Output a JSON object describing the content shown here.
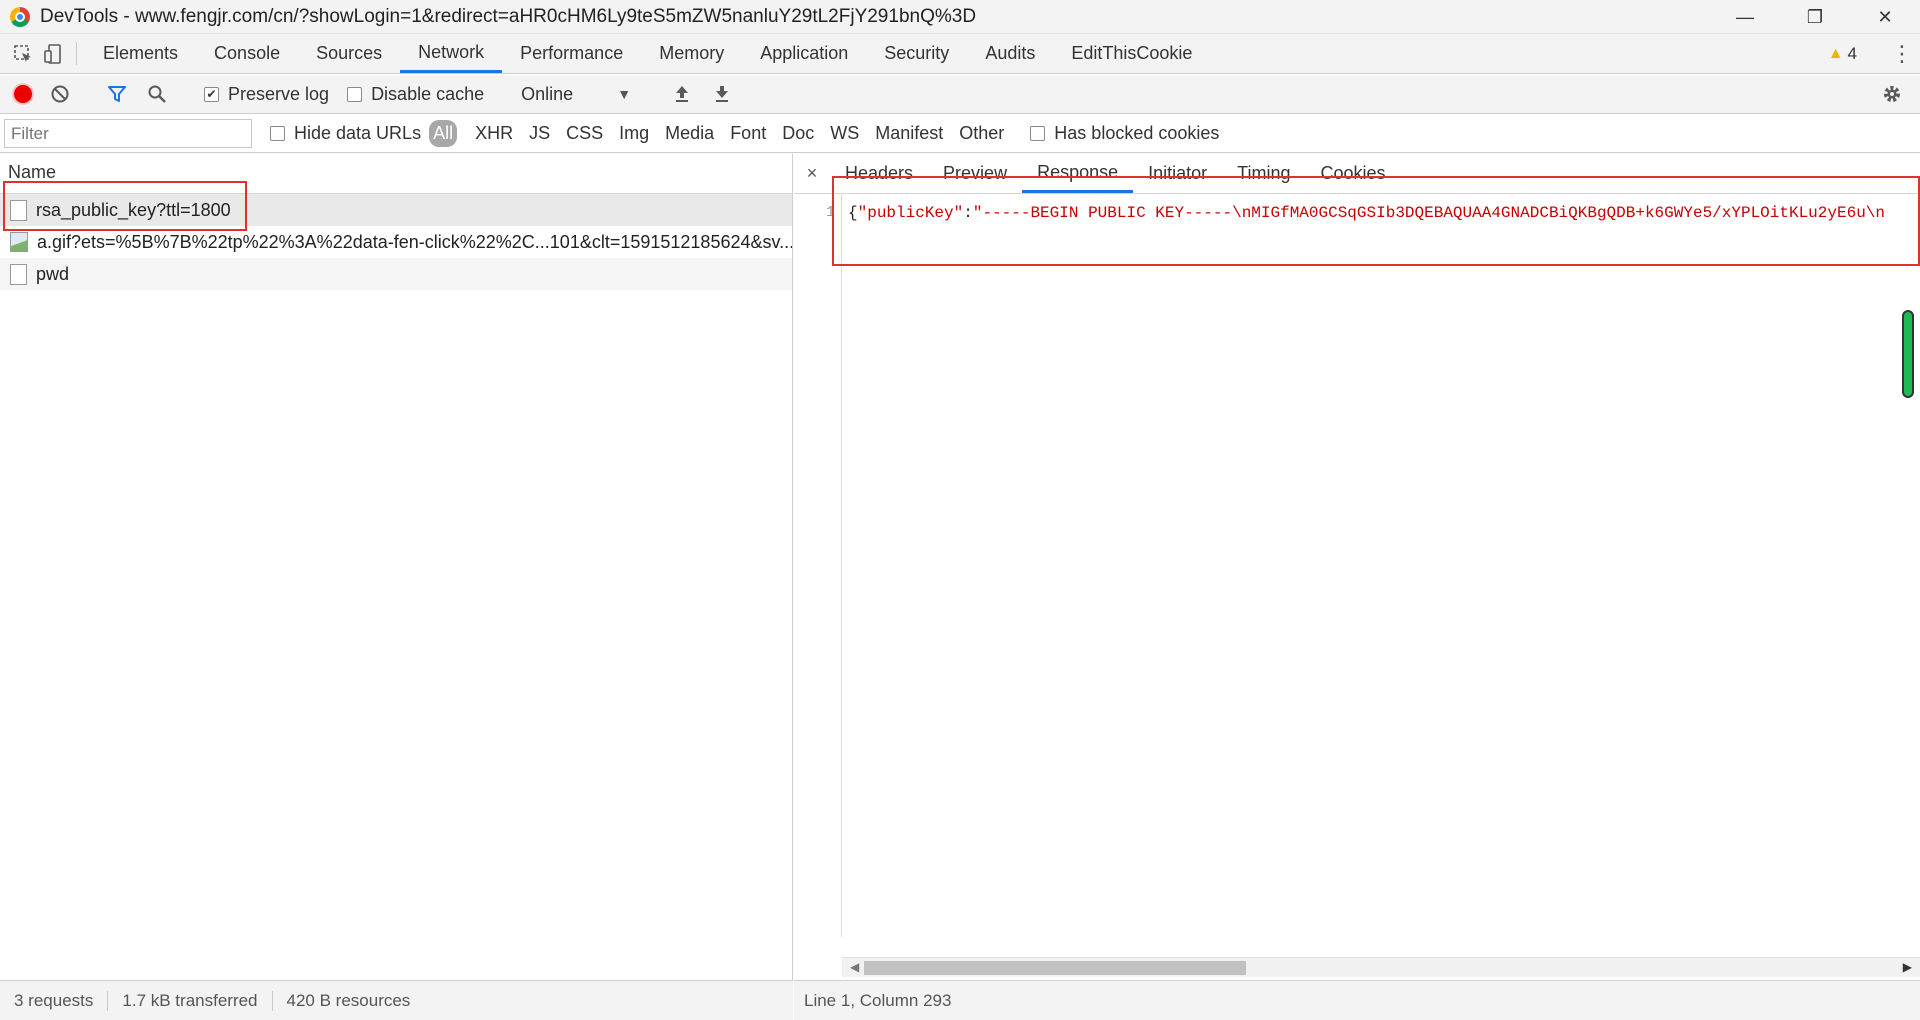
{
  "window": {
    "title": "DevTools - www.fengjr.com/cn/?showLogin=1&redirect=aHR0cHM6Ly9teS5mZW5nanluY29tL2FjY291bnQ%3D",
    "minimize": "—",
    "restore": "❐",
    "close": "✕"
  },
  "tabs": [
    "Elements",
    "Console",
    "Sources",
    "Network",
    "Performance",
    "Memory",
    "Application",
    "Security",
    "Audits",
    "EditThisCookie"
  ],
  "active_tab": "Network",
  "warnings_count": "4",
  "toolbar": {
    "preserve_log_label": "Preserve log",
    "preserve_log_checked": true,
    "disable_cache_label": "Disable cache",
    "disable_cache_checked": false,
    "throttling": "Online"
  },
  "filterbar": {
    "filter_placeholder": "Filter",
    "hide_data_urls_label": "Hide data URLs",
    "types": [
      "All",
      "XHR",
      "JS",
      "CSS",
      "Img",
      "Media",
      "Font",
      "Doc",
      "WS",
      "Manifest",
      "Other"
    ],
    "active_type": "All",
    "blocked_cookies_label": "Has blocked cookies"
  },
  "requests": {
    "column_name": "Name",
    "rows": [
      {
        "name": "rsa_public_key?ttl=1800",
        "icon": "document-icon"
      },
      {
        "name": "a.gif?ets=%5B%7B%22tp%22%3A%22data-fen-click%22%2C...101&clt=1591512185624&sv...",
        "icon": "image-icon"
      },
      {
        "name": "pwd",
        "icon": "document-icon"
      }
    ]
  },
  "status_left": {
    "requests": "3 requests",
    "transferred": "1.7 kB transferred",
    "resources": "420 B resources"
  },
  "detail": {
    "close": "×",
    "tabs": [
      "Headers",
      "Preview",
      "Response",
      "Initiator",
      "Timing",
      "Cookies"
    ],
    "active_tab": "Response",
    "line_number": "1",
    "code_open": "{",
    "code_key": "\"publicKey\"",
    "code_colon": ":",
    "code_value": "\"-----BEGIN PUBLIC KEY-----\\nMIGfMA0GCSqGSIb3DQEBAQUAA4GNADCBiQKBgQDB+k6GWYe5/xYPLOitKLu2yE6u\\n"
  },
  "status_right": "Line 1, Column 293",
  "colors": {
    "accent": "#1a73e8",
    "record": "#ea0000",
    "highlight": "#e03030",
    "string": "#c80000"
  }
}
